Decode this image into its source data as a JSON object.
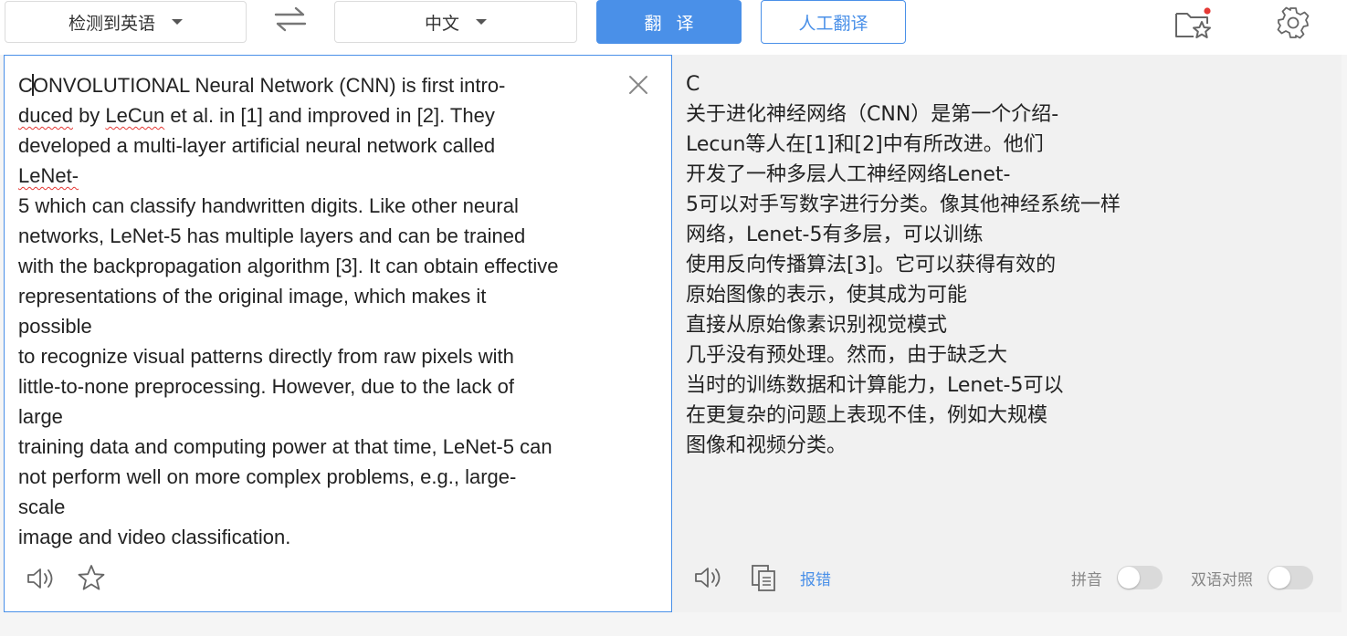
{
  "toolbar": {
    "source_language": "检测到英语",
    "target_language": "中文",
    "translate_label": "翻译",
    "human_translate_label": "人工翻译",
    "favorites_icon": "star-folder-icon",
    "settings_icon": "gear-icon",
    "notification_dot_color": "#e53935"
  },
  "source": {
    "lines": [
      [
        "C",
        "|",
        "ONVOLUTIONAL Neural Network (CNN) is first intro-"
      ],
      [
        "duced",
        " by ",
        "LeCun",
        " et al. in [1] and improved in [2]. They"
      ],
      [
        "developed a multi-layer artificial neural network called"
      ],
      [
        "LeNet-"
      ],
      [
        "5 which can classify handwritten digits. Like other neural"
      ],
      [
        "networks, LeNet-5 has multiple layers and can be trained"
      ],
      [
        "with the backpropagation algorithm [3]. It can obtain effective"
      ],
      [
        "representations of the original image, which makes it"
      ],
      [
        "possible"
      ],
      [
        "to recognize visual patterns directly from raw pixels with"
      ],
      [
        "little-to-none preprocessing. However, due to the lack of"
      ],
      [
        "large"
      ],
      [
        "training data and computing power at that time, LeNet-5 can"
      ],
      [
        "not perform well on more complex problems, e.g., large-"
      ],
      [
        "scale"
      ],
      [
        "image and video classification."
      ]
    ]
  },
  "target": {
    "lines": [
      "C",
      "关于进化神经网络（CNN）是第一个介绍-",
      "Lecun等人在[1]和[2]中有所改进。他们",
      "开发了一种多层人工神经网络Lenet-",
      "5可以对手写数字进行分类。像其他神经系统一样",
      "网络，Lenet-5有多层，可以训练",
      "使用反向传播算法[3]。它可以获得有效的",
      "原始图像的表示，使其成为可能",
      "直接从原始像素识别视觉模式",
      "几乎没有预处理。然而，由于缺乏大",
      "当时的训练数据和计算能力，Lenet-5可以",
      "在更复杂的问题上表现不佳，例如大规模",
      "图像和视频分类。"
    ],
    "report_label": "报错",
    "pinyin_label": "拼音",
    "bilingual_label": "双语对照",
    "pinyin_on": false,
    "bilingual_on": false
  },
  "colors": {
    "accent": "#4a90e8",
    "spell_error": "#e53935"
  }
}
